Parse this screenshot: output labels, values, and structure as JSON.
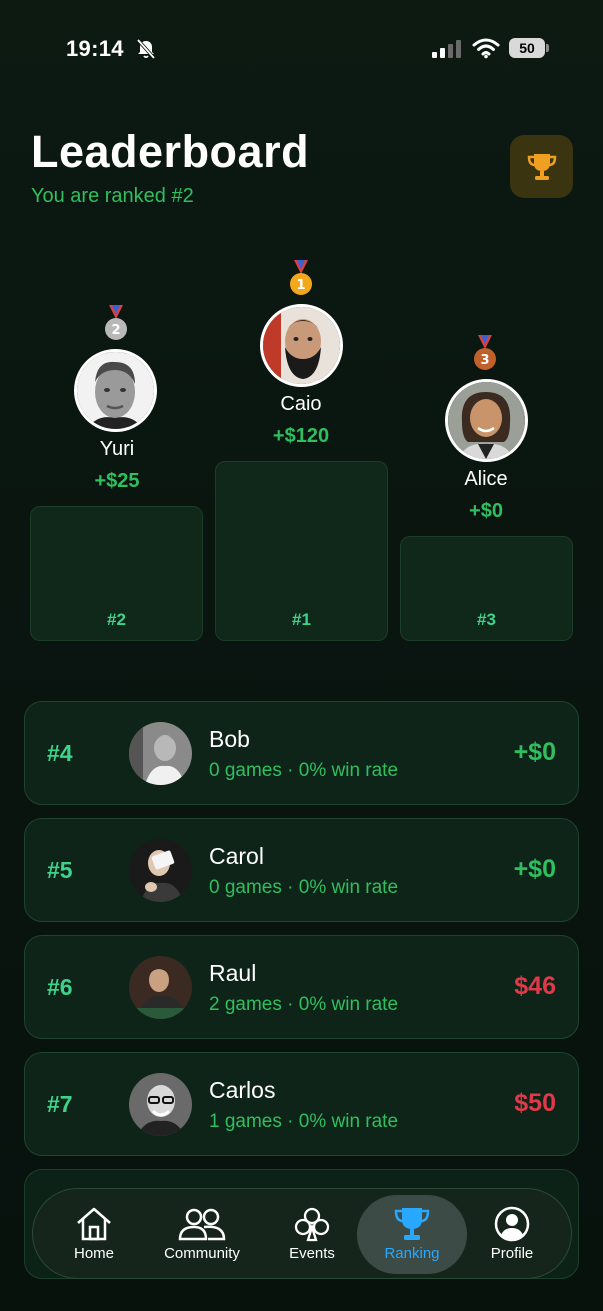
{
  "status_bar": {
    "time": "19:14",
    "battery": "50"
  },
  "header": {
    "title": "Leaderboard",
    "subtitle": "You are ranked #2"
  },
  "podium": [
    {
      "place": "#2",
      "name": "Yuri",
      "amount": "+$25",
      "medal": "2"
    },
    {
      "place": "#1",
      "name": "Caio",
      "amount": "+$120",
      "medal": "1"
    },
    {
      "place": "#3",
      "name": "Alice",
      "amount": "+$0",
      "medal": "3"
    }
  ],
  "rankings": [
    {
      "rank": "#4",
      "name": "Bob",
      "stats": "0 games · 0% win rate",
      "amount": "+$0",
      "amount_color": "#2fbf5f"
    },
    {
      "rank": "#5",
      "name": "Carol",
      "stats": "0 games · 0% win rate",
      "amount": "+$0",
      "amount_color": "#2fbf5f"
    },
    {
      "rank": "#6",
      "name": "Raul",
      "stats": "2 games · 0% win rate",
      "amount": "$46",
      "amount_color": "#e0394a"
    },
    {
      "rank": "#7",
      "name": "Carlos",
      "stats": "1 games · 0% win rate",
      "amount": "$50",
      "amount_color": "#e0394a"
    }
  ],
  "tabs": [
    {
      "label": "Home",
      "icon": "home-icon"
    },
    {
      "label": "Community",
      "icon": "community-icon"
    },
    {
      "label": "Events",
      "icon": "club-icon"
    },
    {
      "label": "Ranking",
      "icon": "trophy-icon",
      "active": true
    },
    {
      "label": "Profile",
      "icon": "profile-icon"
    }
  ],
  "colors": {
    "accent_green": "#2fbf5f",
    "negative_red": "#e0394a",
    "active_tab_blue": "#29a8ff",
    "trophy_gold": "#f0a020"
  }
}
